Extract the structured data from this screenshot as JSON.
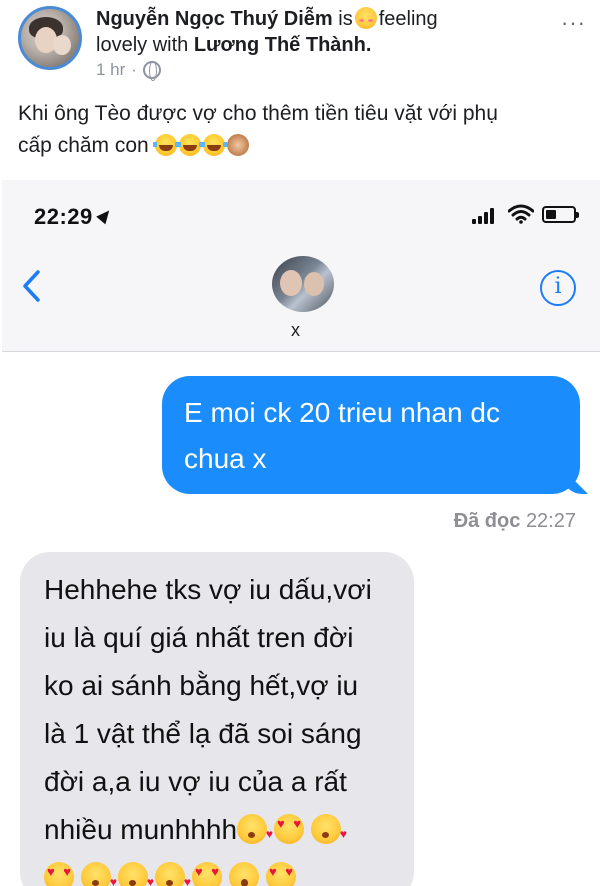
{
  "post": {
    "author": "Nguyễn Ngọc Thuý Diễm",
    "is_text": "is",
    "feeling_text": "feeling",
    "feeling_line2_prefix": "lovely with",
    "tagged": "Lương Thế Thành.",
    "time": "1 hr",
    "separator": "·",
    "more_label": "···",
    "text_line1": "Khi ông Tèo được vợ cho thêm tiền tiêu vặt với phụ",
    "text_line2": "cấp chăm con",
    "icons": [
      "smiling-face-with-hearts-icon",
      "globe-icon",
      "face-with-tears-of-joy-icon",
      "see-no-evil-monkey-icon"
    ]
  },
  "phone": {
    "status_time": "22:29",
    "contact_name": "x",
    "info_label": "i",
    "sent_message_line1": "E moi ck 20 trieu nhan dc",
    "sent_message_line2": "chua x",
    "read_status": "Đã đọc",
    "read_time": "22:27",
    "received_line1": "Hehhehe tks vợ iu dấu,vơi",
    "received_line2": "iu là quí giá nhất tren đời",
    "received_line3": "ko ai sánh bằng hết,vợ iu",
    "received_line4": "là 1 vật thể lạ đã soi sáng",
    "received_line5": "đời a,a iu vợ iu của a rất",
    "received_line6": "nhiều munhhhh",
    "accent_color": "#1a8cfb",
    "received_bubble_color": "#e6e6eb",
    "icons": [
      "location-arrow-icon",
      "signal-icon",
      "wifi-icon",
      "battery-icon",
      "back-chevron-icon",
      "info-icon",
      "kissing-heart-icon",
      "heart-eyes-icon",
      "hushed-face-icon"
    ]
  }
}
